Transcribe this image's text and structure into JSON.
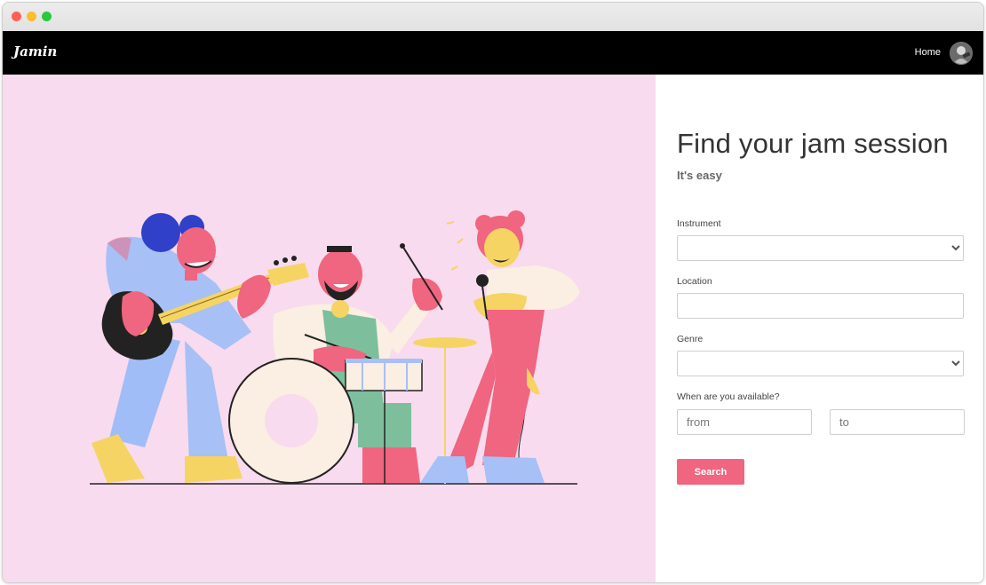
{
  "window": {
    "traffic_lights": [
      "close",
      "minimize",
      "maximize"
    ]
  },
  "navbar": {
    "logo": "Jamin",
    "home_label": "Home",
    "avatar_icon": "user-avatar-icon"
  },
  "hero": {
    "background_color": "#f8dbee",
    "illustration": "band-illustration"
  },
  "form": {
    "title": "Find your jam session",
    "subtitle": "It's easy",
    "instrument": {
      "label": "Instrument",
      "value": ""
    },
    "location": {
      "label": "Location",
      "value": ""
    },
    "genre": {
      "label": "Genre",
      "value": ""
    },
    "availability": {
      "label": "When are you available?",
      "from_placeholder": "from",
      "to_placeholder": "to"
    },
    "search_label": "Search",
    "accent_color": "#f0657f"
  }
}
